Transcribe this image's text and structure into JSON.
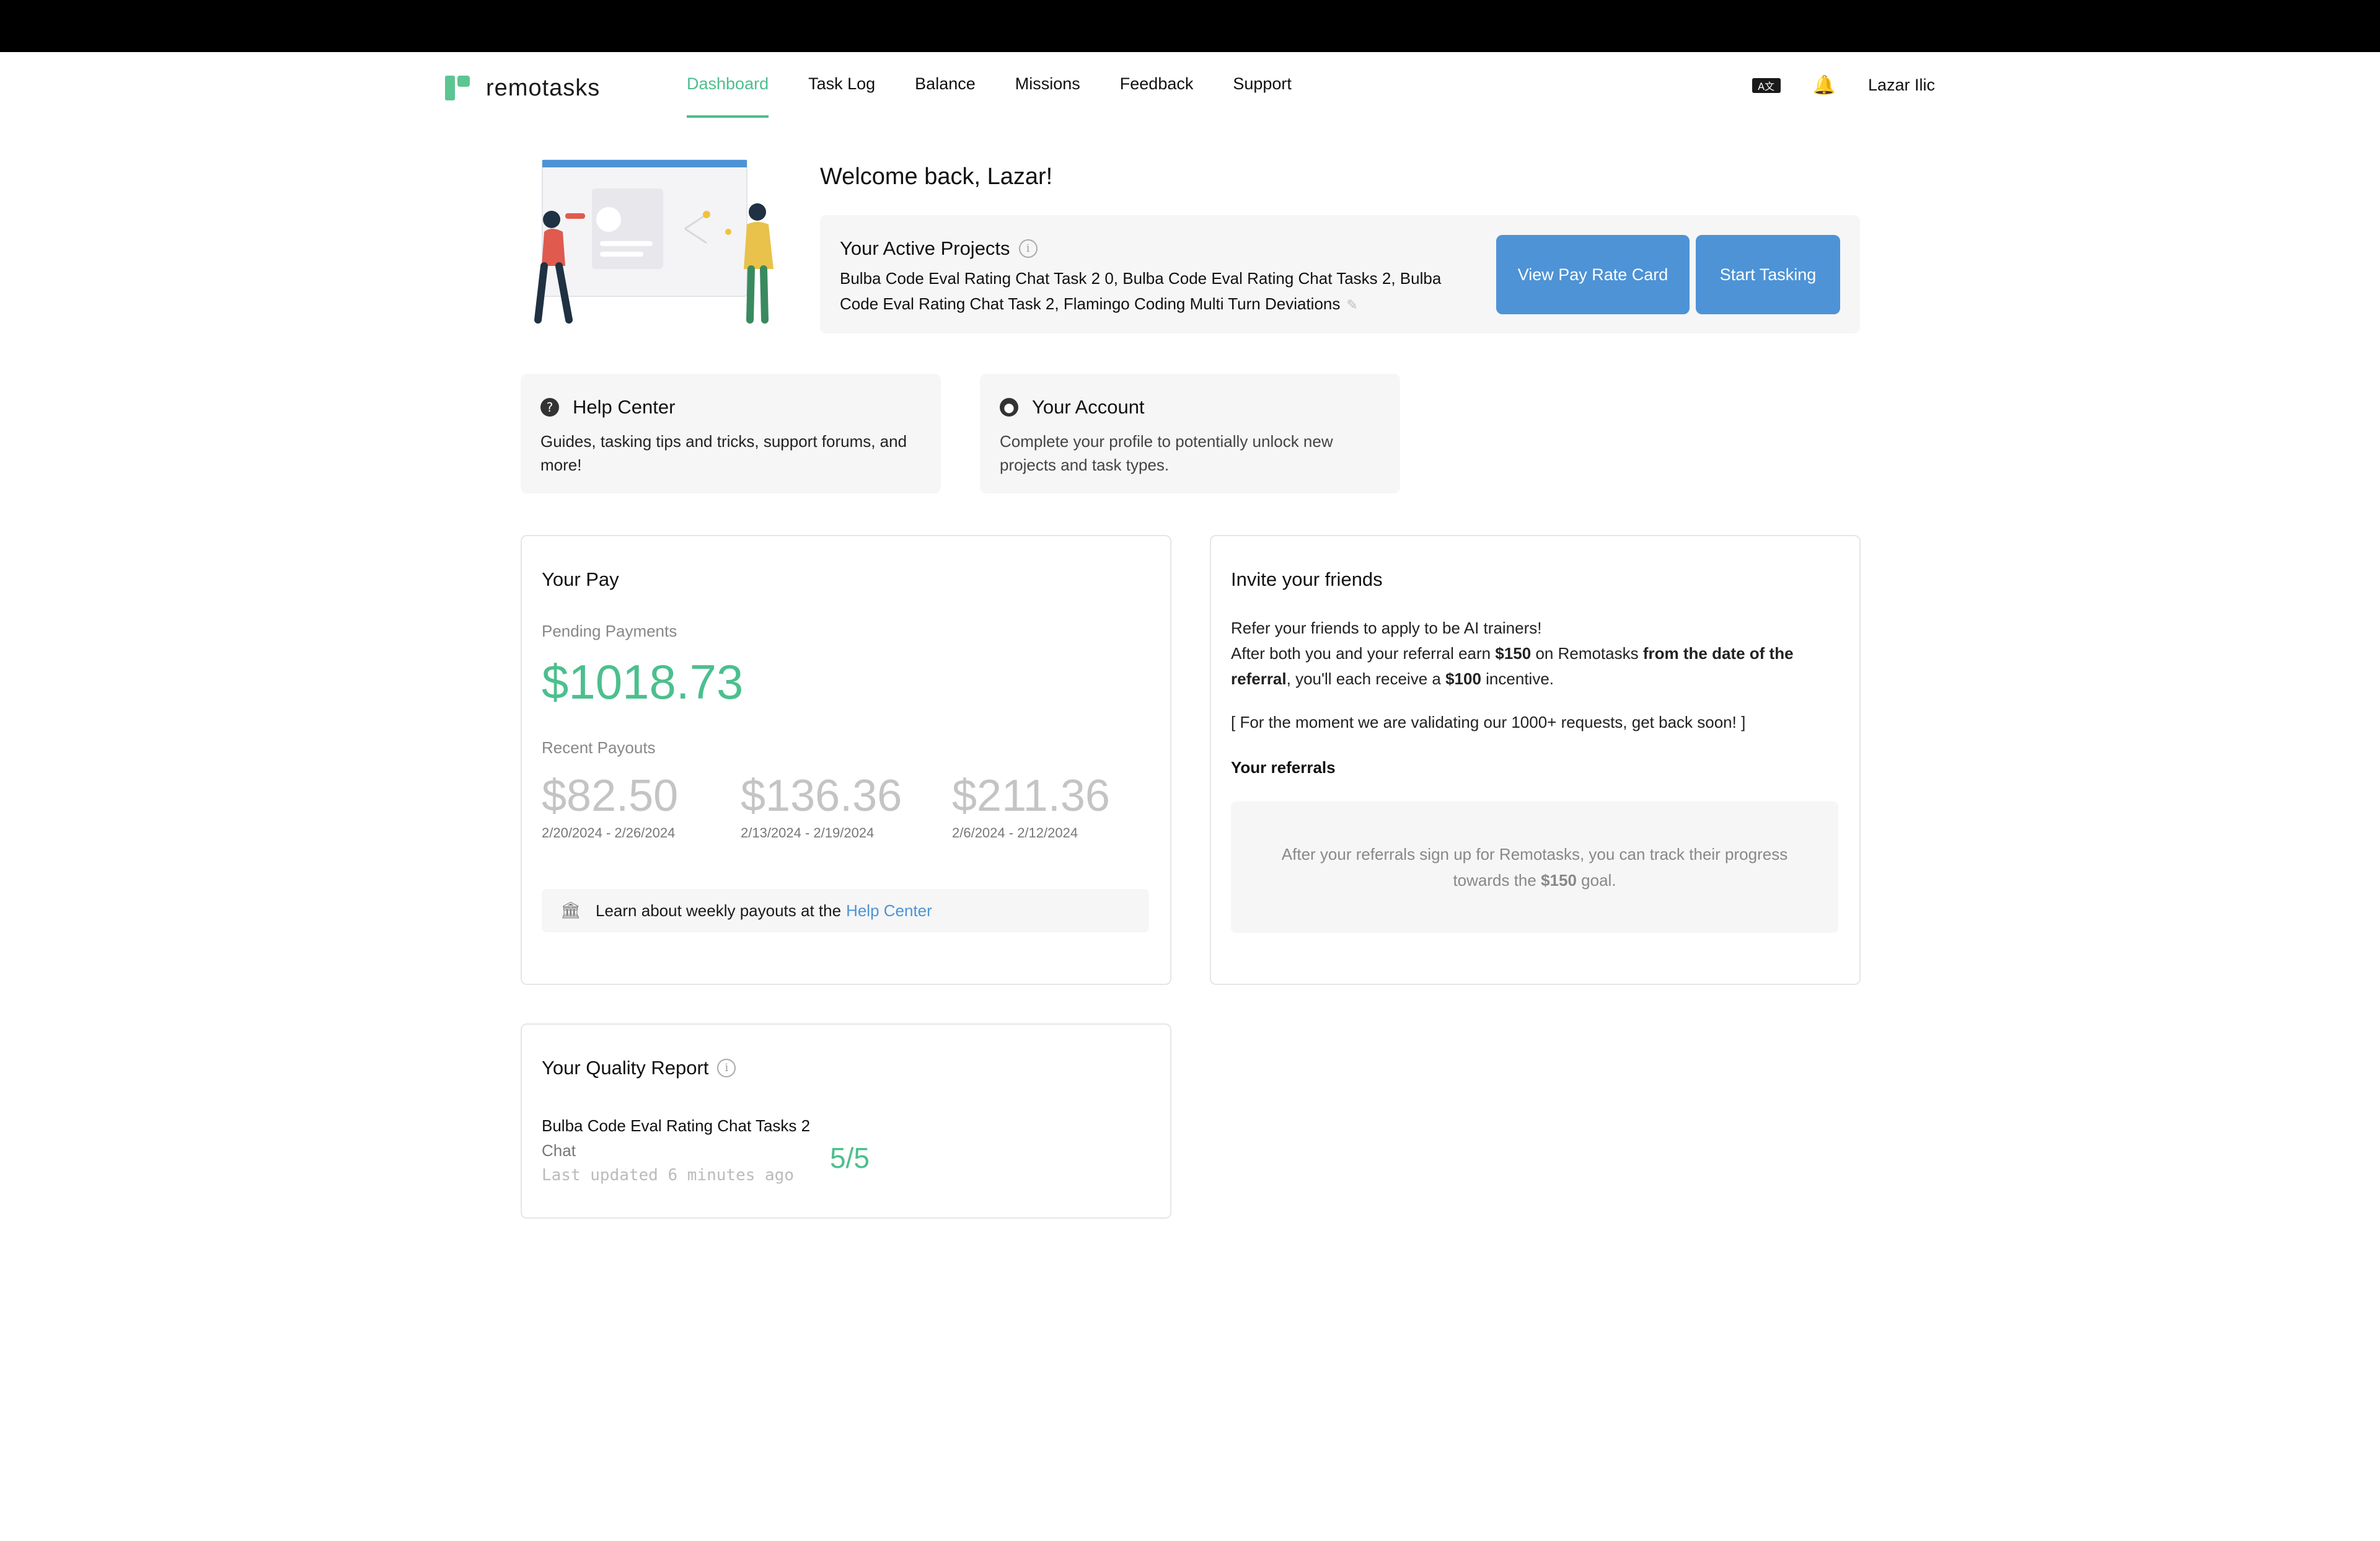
{
  "app": {
    "logo_text": "remotasks",
    "brand_color": "#4cbf8e",
    "link_color": "#4d93d6"
  },
  "nav": {
    "items": [
      {
        "label": "Dashboard",
        "active": true
      },
      {
        "label": "Task Log"
      },
      {
        "label": "Balance"
      },
      {
        "label": "Missions"
      },
      {
        "label": "Feedback"
      },
      {
        "label": "Support"
      }
    ],
    "language_icon": "translate-icon",
    "notification_icon": "bell-icon",
    "user_name": "Lazar Ilic"
  },
  "welcome": {
    "title": "Welcome back, Lazar!"
  },
  "projects": {
    "title": "Your Active Projects",
    "list": "Bulba Code Eval Rating Chat Task 2 0, Bulba Code Eval Rating Chat Tasks 2, Bulba Code Eval Rating Chat Task 2, Flamingo Coding Multi Turn Deviations",
    "pay_rate_button": "View Pay Rate Card",
    "start_button": "Start Tasking"
  },
  "help_center": {
    "title": "Help Center",
    "description": "Guides, tasking tips and tricks, support forums, and more!"
  },
  "account": {
    "title": "Your Account",
    "description": "Complete your profile to potentially unlock new projects and task types."
  },
  "pay": {
    "title": "Your Pay",
    "pending_label": "Pending Payments",
    "pending_amount": "$1018.73",
    "recent_label": "Recent Payouts",
    "payouts": [
      {
        "amount": "$82.50",
        "range": "2/20/2024 - 2/26/2024"
      },
      {
        "amount": "$136.36",
        "range": "2/13/2024 - 2/19/2024"
      },
      {
        "amount": "$211.36",
        "range": "2/6/2024 - 2/12/2024"
      }
    ],
    "learn_text": "Learn about weekly payouts at the",
    "learn_link": "Help Center"
  },
  "invite": {
    "title": "Invite your friends",
    "line1": "Refer your friends to apply to be AI trainers!",
    "line2_a": "After both you and your referral earn",
    "line2_b": "$150",
    "line2_c": "on Remotasks",
    "line2_d": "from the date of the referral",
    "line2_e": ", you'll each receive a",
    "line2_f": "$100",
    "line2_g": "incentive.",
    "validating": "[ For the moment we are validating our 1000+ requests, get back soon! ]",
    "referrals_label": "Your referrals",
    "empty_a": "After your referrals sign up for Remotasks, you can track their progress towards the",
    "empty_b": "$150",
    "empty_c": "goal."
  },
  "quality": {
    "title": "Your Quality Report",
    "project": "Bulba Code Eval Rating Chat Tasks 2",
    "type": "Chat",
    "updated": "Last updated 6 minutes ago",
    "score": "5/5"
  }
}
